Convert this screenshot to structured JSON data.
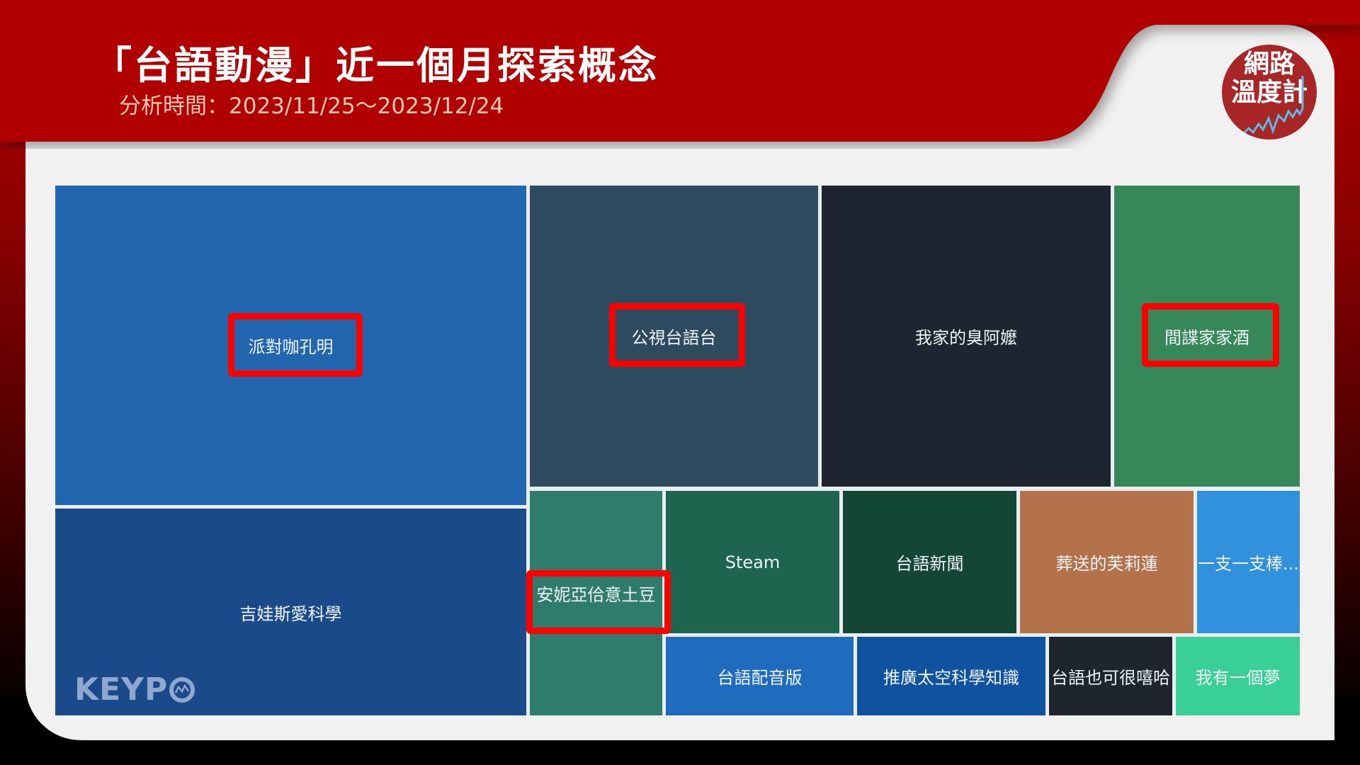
{
  "header": {
    "title": "「台語動漫」近一個月探索概念",
    "subtitle": "分析時間：2023/11/25～2023/12/24"
  },
  "brand": {
    "logo_line1": "網路",
    "logo_line2": "溫度計",
    "watermark": "KEYP"
  },
  "colors": {
    "header_red": "#b00000",
    "highlight": "#ff0000",
    "card_bg": "#f1f1f1"
  },
  "chart_data": {
    "type": "treemap",
    "title": "「台語動漫」近一個月探索概念",
    "subtitle": "分析時間：2023/11/25～2023/12/24",
    "items": [
      {
        "label": "派對咖孔明",
        "weight": 24.9,
        "color": "#2166ae",
        "highlighted": true
      },
      {
        "label": "吉娃斯愛科學",
        "weight": 15.9,
        "color": "#1a4a89",
        "highlighted": false
      },
      {
        "label": "公視台語台",
        "weight": 11.1,
        "color": "#2e4a5e",
        "highlighted": true
      },
      {
        "label": "我家的臭阿嬤",
        "weight": 11.1,
        "color": "#1f2530",
        "highlighted": false
      },
      {
        "label": "間諜家家酒",
        "weight": 7.2,
        "color": "#368859",
        "highlighted": true
      },
      {
        "label": "安妮亞佮意土豆",
        "weight": 4.6,
        "color": "#2f7c6d",
        "highlighted": true
      },
      {
        "label": "Steam",
        "weight": 3.8,
        "color": "#1e6550",
        "highlighted": false
      },
      {
        "label": "台語新聞",
        "weight": 3.8,
        "color": "#134634",
        "highlighted": false
      },
      {
        "label": "葬送的芙莉蓮",
        "weight": 3.8,
        "color": "#b4724a",
        "highlighted": false
      },
      {
        "label": "一支一支棒...",
        "weight": 2.3,
        "color": "#3291dc",
        "highlighted": false
      },
      {
        "label": "台語配音版",
        "weight": 2.4,
        "color": "#1f6cbf",
        "highlighted": false
      },
      {
        "label": "推廣太空科學知識",
        "weight": 2.4,
        "color": "#0f52a0",
        "highlighted": false
      },
      {
        "label": "台語也可很嘻哈",
        "weight": 1.6,
        "color": "#1f252e",
        "highlighted": false
      },
      {
        "label": "我有一個夢",
        "weight": 1.6,
        "color": "#3bcf98",
        "highlighted": false
      }
    ]
  }
}
